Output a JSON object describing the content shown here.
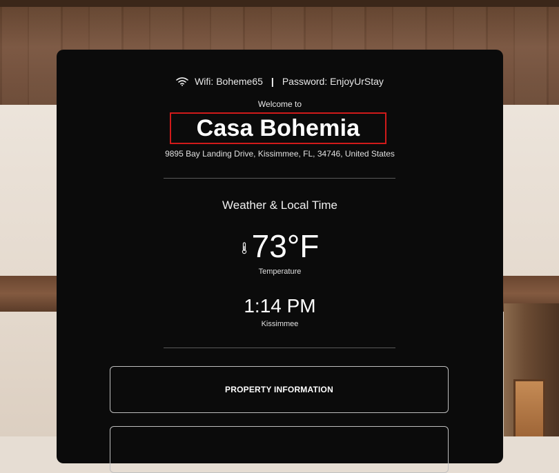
{
  "wifi": {
    "network_text": "Wifi: Boheme65",
    "separator": "|",
    "password_text": "Password: EnjoyUrStay",
    "icon": "wifi-icon"
  },
  "welcome_text": "Welcome to",
  "property_name": "Casa Bohemia",
  "address": "9895 Bay Landing Drive, Kissimmee, FL, 34746, United States",
  "weather": {
    "section_title": "Weather & Local Time",
    "temperature": "73°F",
    "temperature_label": "Temperature",
    "temperature_icon": "thermometer-icon",
    "time": "1:14 PM",
    "location": "Kissimmee"
  },
  "menu": {
    "property_information": "PROPERTY INFORMATION",
    "second_item": ""
  },
  "colors": {
    "panel_bg": "#0b0b0b",
    "highlight_border": "#d11a1a",
    "button_border": "#bfbfbf"
  }
}
